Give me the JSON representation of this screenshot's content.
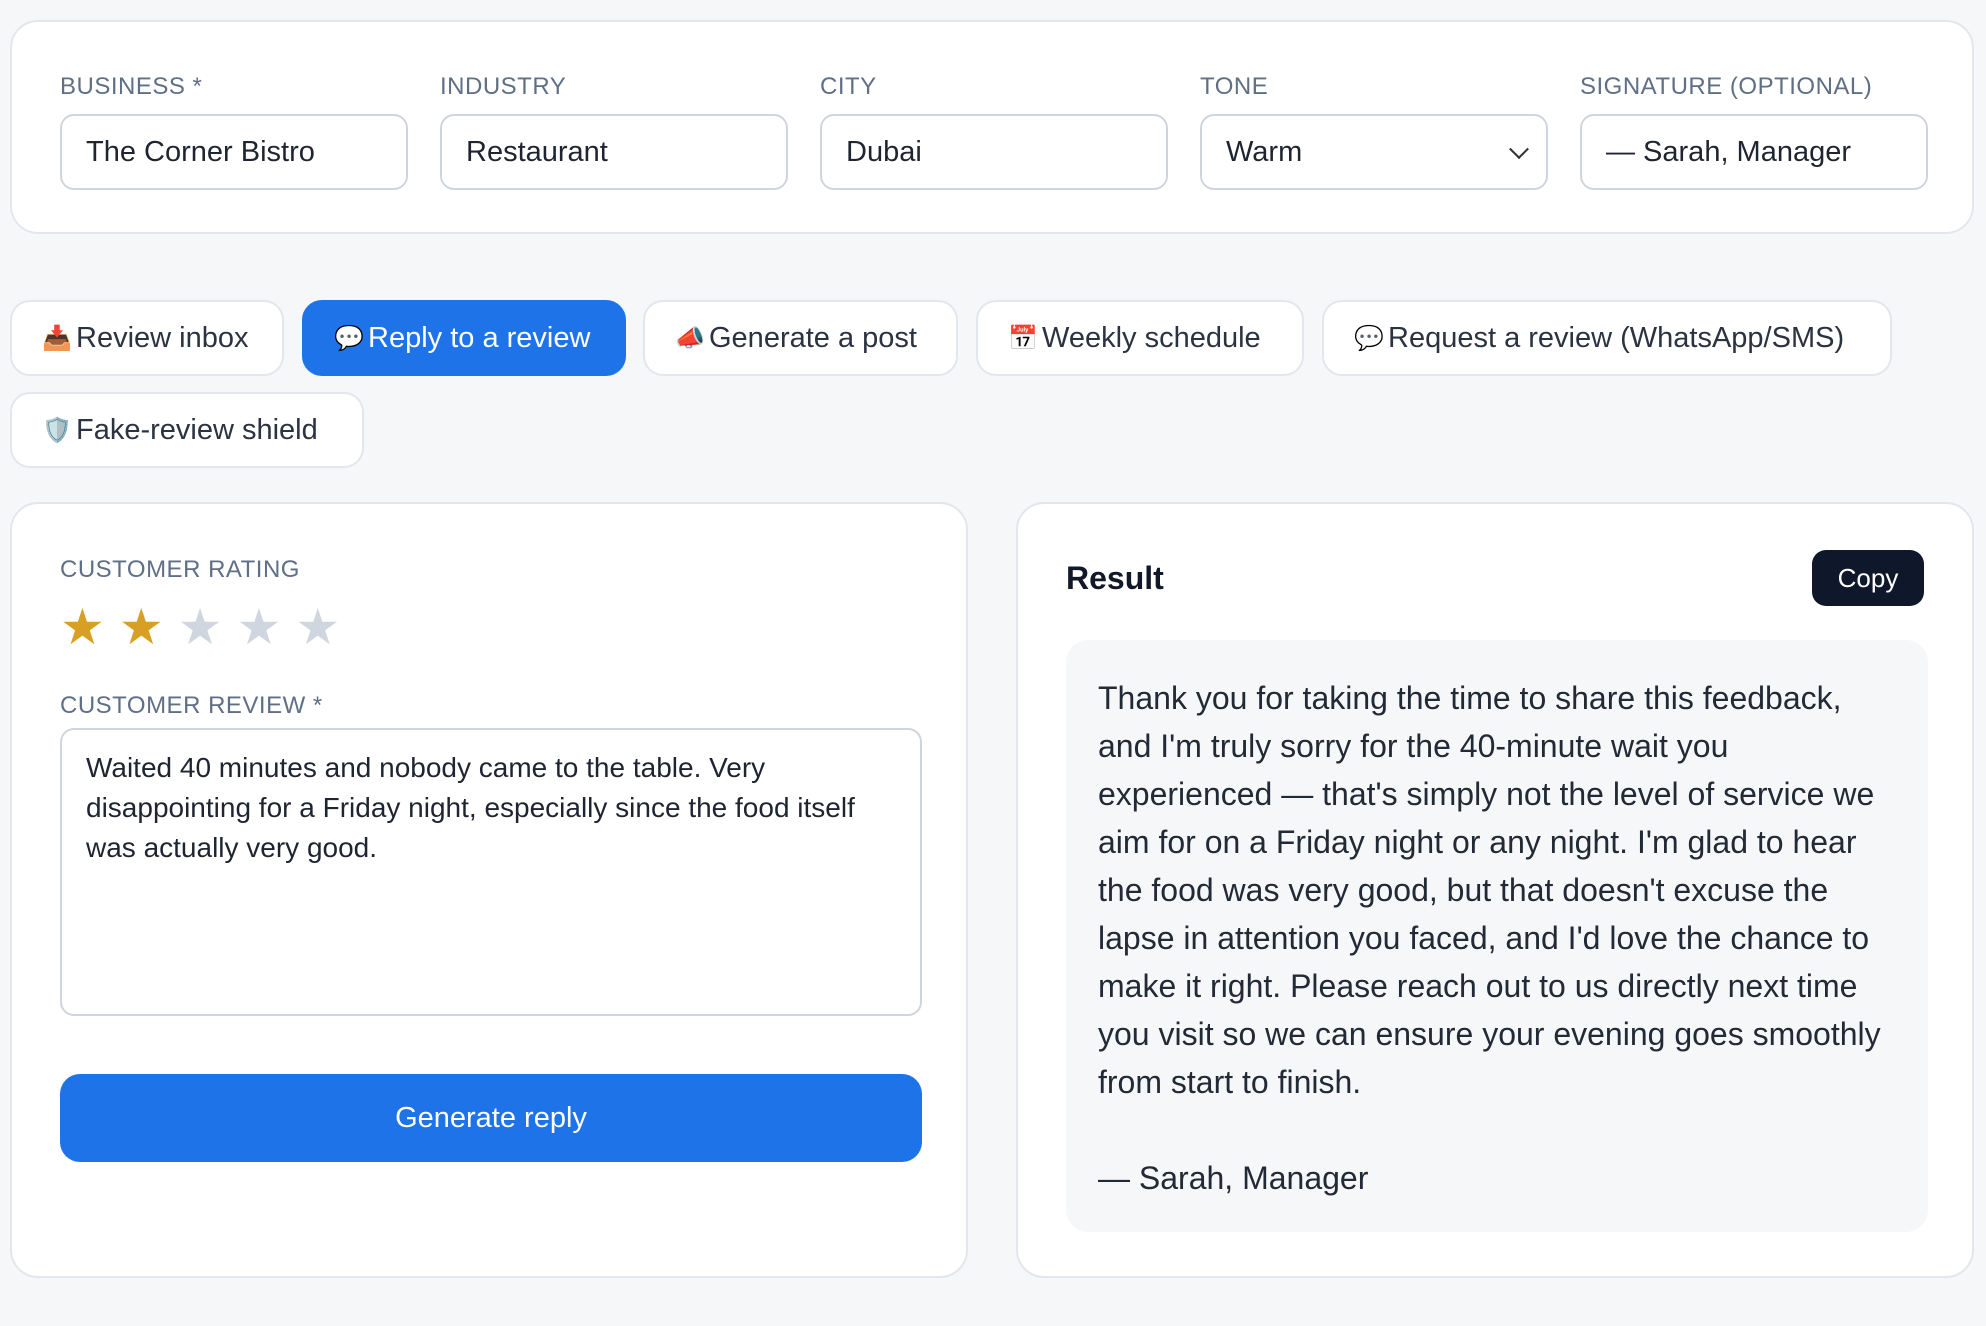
{
  "settings": {
    "business": {
      "label": "BUSINESS *",
      "value": "The Corner Bistro"
    },
    "industry": {
      "label": "INDUSTRY",
      "value": "Restaurant"
    },
    "city": {
      "label": "CITY",
      "value": "Dubai"
    },
    "tone": {
      "label": "TONE",
      "value": "Warm"
    },
    "signature": {
      "label": "SIGNATURE (OPTIONAL)",
      "value": "— Sarah, Manager"
    }
  },
  "tabs": [
    {
      "label": "Review inbox",
      "icon": "📥",
      "icon_name": "inbox-tray-icon",
      "active": false
    },
    {
      "label": "Reply to a review",
      "icon": "💬",
      "icon_name": "speech-bubble-icon",
      "active": true
    },
    {
      "label": "Generate a post",
      "icon": "📣",
      "icon_name": "megaphone-icon",
      "active": false
    },
    {
      "label": "Weekly schedule",
      "icon": "📅",
      "icon_name": "calendar-icon",
      "active": false
    },
    {
      "label": "Request a review (WhatsApp/SMS)",
      "icon": "💬",
      "icon_name": "speech-bubble-icon",
      "active": false
    },
    {
      "label": "Fake-review shield",
      "icon": "🛡️",
      "icon_name": "shield-icon",
      "active": false
    }
  ],
  "reply_form": {
    "rating_label": "CUSTOMER RATING",
    "rating": 2,
    "rating_max": 5,
    "review_label": "CUSTOMER REVIEW *",
    "review_text": "Waited 40 minutes and nobody came to the table. Very disappointing for a Friday night, especially since the food itself was actually very good.",
    "generate_label": "Generate reply"
  },
  "result": {
    "title": "Result",
    "copy_label": "Copy",
    "body": "Thank you for taking the time to share this feedback, and I'm truly sorry for the 40-minute wait you experienced — that's simply not the level of service we aim for on a Friday night or any night. I'm glad to hear the food was very good, but that doesn't excuse the lapse in attention you faced, and I'd love the chance to make it right. Please reach out to us directly next time you visit so we can ensure your evening goes smoothly from start to finish.",
    "signature": "— Sarah, Manager"
  },
  "colors": {
    "accent": "#1e73e8",
    "star_filled": "#d89f25",
    "star_empty": "#d0d6e0",
    "copy_button": "#0f172a"
  }
}
